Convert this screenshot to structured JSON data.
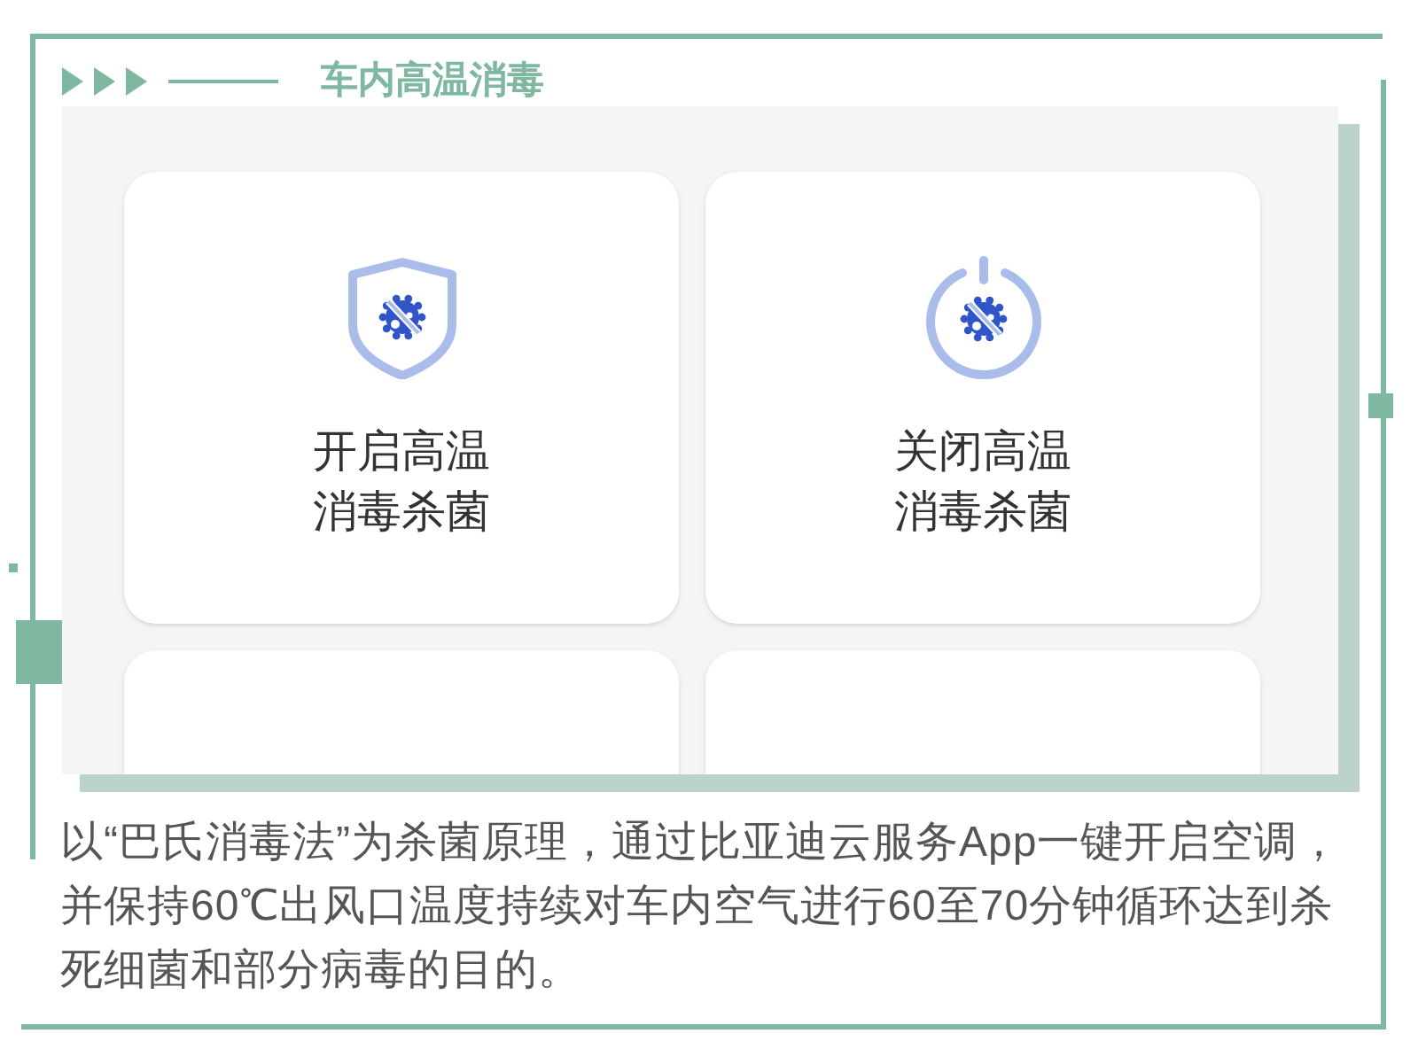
{
  "header": {
    "title": "车内高温消毒"
  },
  "cards": [
    {
      "kind": "shield",
      "label": [
        "开启高温",
        "消毒杀菌"
      ]
    },
    {
      "kind": "power",
      "label": [
        "关闭高温",
        "消毒杀菌"
      ]
    },
    {
      "kind": "blank"
    },
    {
      "kind": "blank"
    }
  ],
  "caption": "以“巴氏消毒法”为杀菌原理，通过比亚迪云服务App一键开启空调，并保持60℃出风口温度持续对车内空气进行60至70分钟循环达到杀死细菌和部分病毒的目的。"
}
